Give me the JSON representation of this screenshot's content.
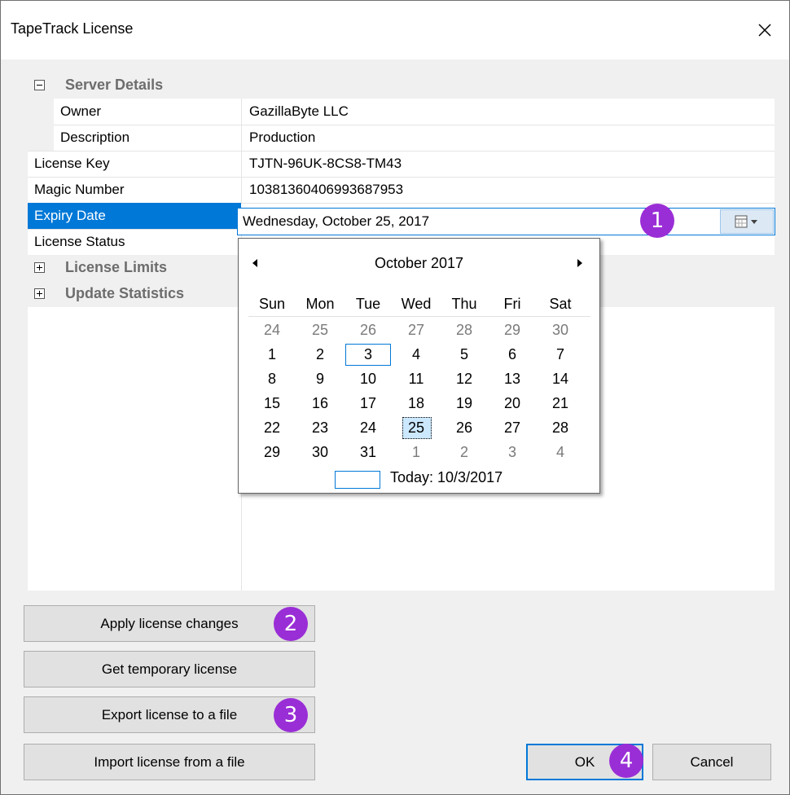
{
  "window": {
    "title": "TapeTrack License"
  },
  "grid": {
    "categories": {
      "server_details": "Server Details",
      "license_limits": "License Limits",
      "update_statistics": "Update Statistics"
    },
    "rows": {
      "owner": {
        "label": "Owner",
        "value": "GazillaByte LLC"
      },
      "description": {
        "label": "Description",
        "value": "Production"
      },
      "license_key": {
        "label": "License Key",
        "value": "TJTN-96UK-8CS8-TM43"
      },
      "magic_number": {
        "label": "Magic Number",
        "value": "10381360406993687953"
      },
      "expiry_date": {
        "label": "Expiry Date",
        "value": "Wednesday,   October   25, 2017"
      },
      "license_status": {
        "label": "License Status",
        "value": ""
      }
    }
  },
  "calendar": {
    "month_label": "October 2017",
    "days_of_week": [
      "Sun",
      "Mon",
      "Tue",
      "Wed",
      "Thu",
      "Fri",
      "Sat"
    ],
    "weeks": [
      [
        "24",
        "25",
        "26",
        "27",
        "28",
        "29",
        "30"
      ],
      [
        "1",
        "2",
        "3",
        "4",
        "5",
        "6",
        "7"
      ],
      [
        "8",
        "9",
        "10",
        "11",
        "12",
        "13",
        "14"
      ],
      [
        "15",
        "16",
        "17",
        "18",
        "19",
        "20",
        "21"
      ],
      [
        "22",
        "23",
        "24",
        "25",
        "26",
        "27",
        "28"
      ],
      [
        "29",
        "30",
        "31",
        "1",
        "2",
        "3",
        "4"
      ]
    ],
    "today_label": "Today: 10/3/2017"
  },
  "buttons": {
    "apply": "Apply license changes",
    "temporary": "Get temporary license",
    "export": "Export license to a file",
    "import": "Import license from a file",
    "ok": "OK",
    "cancel": "Cancel"
  },
  "badges": [
    "1",
    "2",
    "3",
    "4"
  ],
  "colors": {
    "accent": "#0078d7",
    "badge": "#9a2ed6",
    "selection": "#cce8ff"
  }
}
